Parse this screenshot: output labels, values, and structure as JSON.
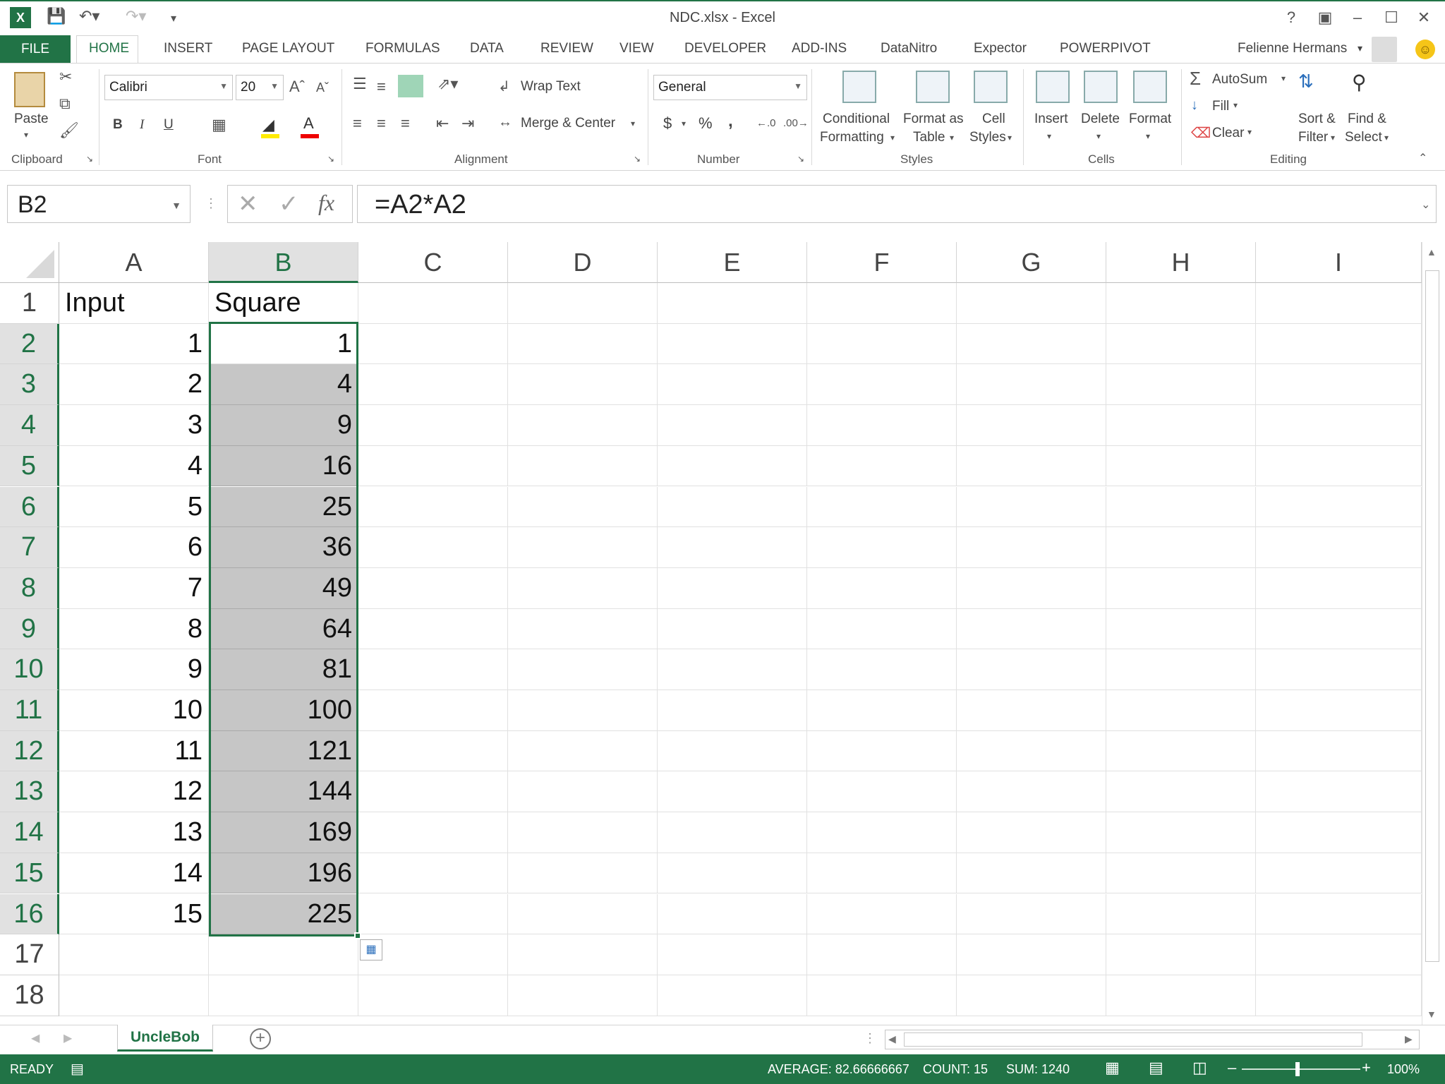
{
  "window": {
    "title": "NDC.xlsx - Excel"
  },
  "user": {
    "name": "Felienne Hermans"
  },
  "tabs": [
    "FILE",
    "HOME",
    "INSERT",
    "PAGE LAYOUT",
    "FORMULAS",
    "DATA",
    "REVIEW",
    "VIEW",
    "DEVELOPER",
    "ADD-INS",
    "DataNitro",
    "Expector",
    "POWERPIVOT"
  ],
  "ribbon": {
    "clipboard": {
      "label": "Clipboard",
      "paste": "Paste"
    },
    "font": {
      "label": "Font",
      "name": "Calibri",
      "size": "20",
      "bold": "B",
      "italic": "I",
      "underline": "U"
    },
    "alignment": {
      "label": "Alignment",
      "wrap": "Wrap Text",
      "merge": "Merge & Center"
    },
    "number": {
      "label": "Number",
      "format": "General",
      "currency": "$",
      "percent": "%",
      "comma": ","
    },
    "styles": {
      "label": "Styles",
      "conditional_1": "Conditional",
      "conditional_2": "Formatting",
      "format_table_1": "Format as",
      "format_table_2": "Table",
      "cell_styles_1": "Cell",
      "cell_styles_2": "Styles"
    },
    "cells": {
      "label": "Cells",
      "insert": "Insert",
      "delete": "Delete",
      "format": "Format"
    },
    "editing": {
      "label": "Editing",
      "autosum": "AutoSum",
      "fill": "Fill",
      "clear": "Clear",
      "sort_1": "Sort &",
      "sort_2": "Filter",
      "find_1": "Find &",
      "find_2": "Select"
    }
  },
  "formula_bar": {
    "name_box": "B2",
    "formula": "=A2*A2",
    "fx": "fx"
  },
  "columns": [
    "A",
    "B",
    "C",
    "D",
    "E",
    "F",
    "G",
    "H",
    "I"
  ],
  "rows": [
    "1",
    "2",
    "3",
    "4",
    "5",
    "6",
    "7",
    "8",
    "9",
    "10",
    "11",
    "12",
    "13",
    "14",
    "15",
    "16",
    "17",
    "18"
  ],
  "cells": {
    "A": [
      "Input",
      "1",
      "2",
      "3",
      "4",
      "5",
      "6",
      "7",
      "8",
      "9",
      "10",
      "11",
      "12",
      "13",
      "14",
      "15",
      "",
      ""
    ],
    "B": [
      "Square",
      "1",
      "4",
      "9",
      "16",
      "25",
      "36",
      "49",
      "64",
      "81",
      "100",
      "121",
      "144",
      "169",
      "196",
      "225",
      "",
      ""
    ]
  },
  "sheet": {
    "active_tab": "UncleBob"
  },
  "status": {
    "mode": "READY",
    "average": "AVERAGE: 82.66666667",
    "count": "COUNT: 15",
    "sum": "SUM: 1240",
    "zoom": "100%"
  }
}
